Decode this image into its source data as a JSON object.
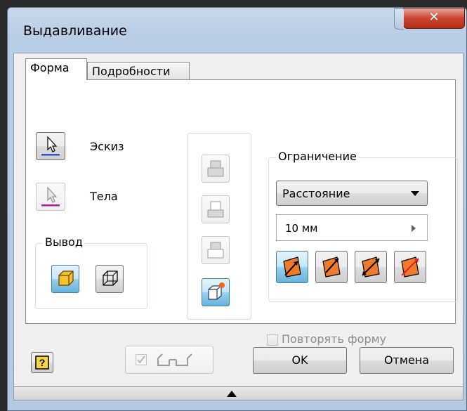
{
  "window": {
    "title": "Выдавливание"
  },
  "tabs": [
    {
      "label": "Форма"
    },
    {
      "label": "Подробности"
    }
  ],
  "profile": {
    "sketch_label": "Эскиз",
    "solids_label": "Тела"
  },
  "output": {
    "title": "Вывод"
  },
  "extents": {
    "title": "Ограничение",
    "type_value": "Расстояние",
    "distance_value": "10 мм"
  },
  "match_shape": {
    "label": "Повторять форму",
    "checked": false
  },
  "footer": {
    "ok_label": "OK",
    "cancel_label": "Отмена",
    "help_glyph": "?"
  },
  "colors": {
    "accent_blue": "#2a56d8",
    "accent_magenta": "#c2188f",
    "pressed": "#68b3db"
  }
}
